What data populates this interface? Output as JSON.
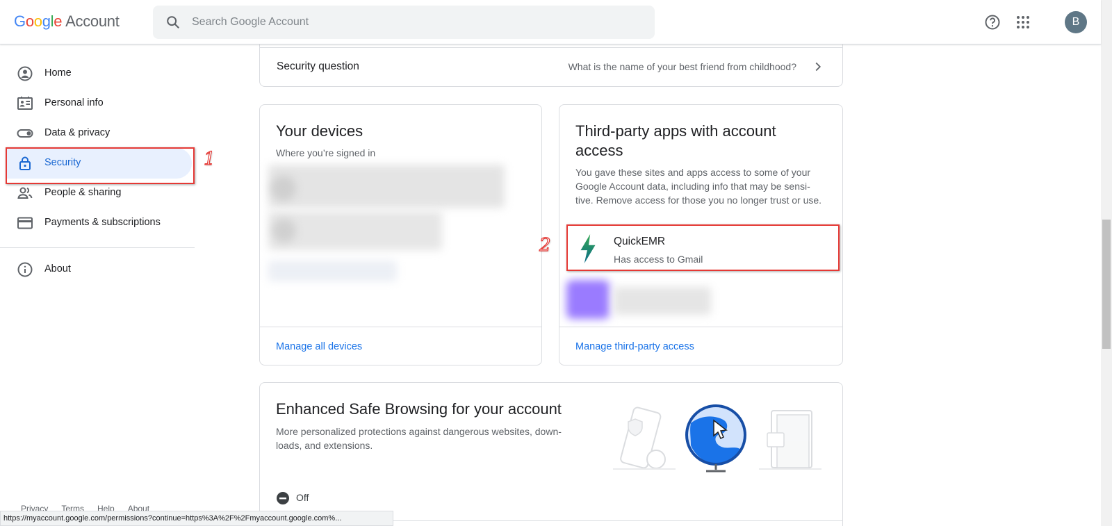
{
  "header": {
    "logo_google": "Google",
    "logo_account": "Account",
    "search_placeholder": "Search Google Account",
    "avatar_letter": "B"
  },
  "sidebar": {
    "items": [
      {
        "label": "Home",
        "icon": "home-icon"
      },
      {
        "label": "Personal info",
        "icon": "id-card-icon"
      },
      {
        "label": "Data & privacy",
        "icon": "toggle-icon"
      },
      {
        "label": "Security",
        "icon": "lock-icon",
        "active": true
      },
      {
        "label": "People & sharing",
        "icon": "people-icon"
      },
      {
        "label": "Payments & subscriptions",
        "icon": "credit-card-icon"
      },
      {
        "label": "About",
        "icon": "info-icon"
      }
    ],
    "footer": [
      "Privacy",
      "Terms",
      "Help",
      "About"
    ]
  },
  "security_question": {
    "label": "Security question",
    "value": "What is the name of your best friend from childhood?"
  },
  "devices_card": {
    "title": "Your devices",
    "subtitle": "Where you’re signed in",
    "link": "Manage all devices"
  },
  "third_party_card": {
    "title": "Third-party apps with account access",
    "description": "You gave these sites and apps access to some of your Google Account data, including info that may be sensi-tive. Remove access for those you no longer trust or use.",
    "app": {
      "name": "QuickEMR",
      "access": "Has access to Gmail"
    },
    "link": "Manage third-party access"
  },
  "safe_browsing_card": {
    "title": "Enhanced Safe Browsing for your account",
    "description": "More personalized protections against dangerous websites, down-loads, and extensions.",
    "status": "Off"
  },
  "annotations": {
    "one": "1",
    "two": "2"
  },
  "status_bar": "https://myaccount.google.com/permissions?continue=https%3A%2F%2Fmyaccount.google.com%...",
  "colors": {
    "accent": "#1a73e8",
    "active_bg": "#e8f0fe",
    "annotation_red": "#e53935",
    "quickemr_green": "#1e8e3e"
  }
}
